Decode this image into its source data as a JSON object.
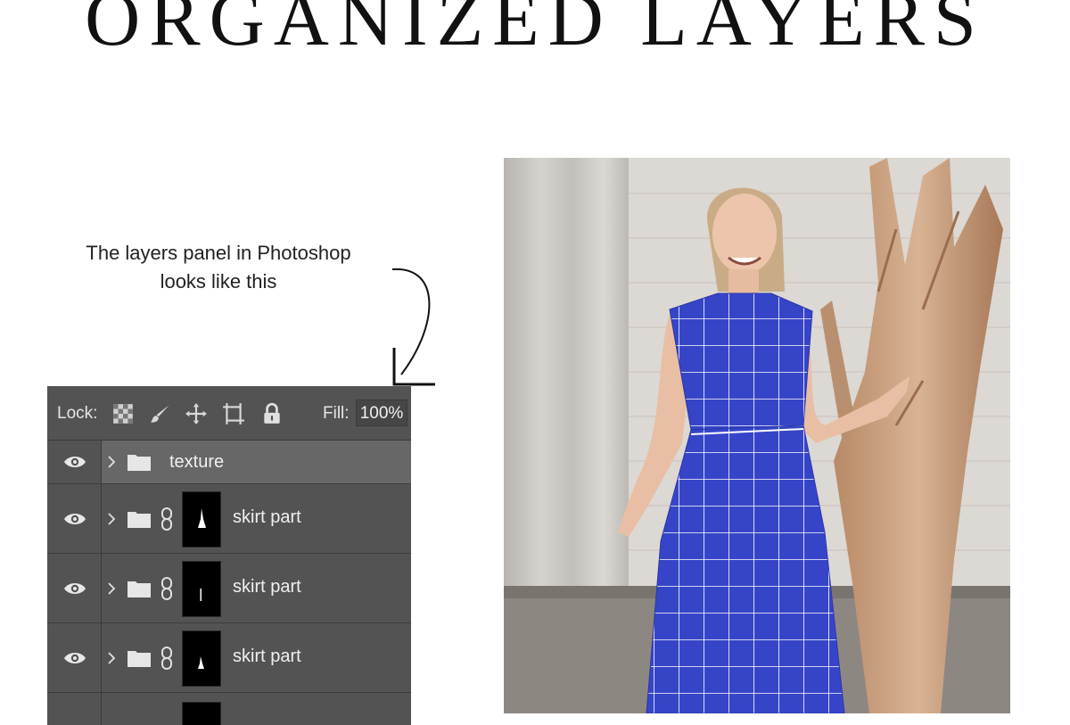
{
  "title": "ORGANIZED LAYERS",
  "caption": {
    "line1": "The layers panel in Photoshop",
    "line2": "looks like this"
  },
  "layers_panel": {
    "lock_label": "Lock:",
    "lock_icons": [
      "transparent-pixels-lock-icon",
      "brush-lock-icon",
      "move-lock-icon",
      "artboard-lock-icon",
      "padlock-icon"
    ],
    "fill_label": "Fill:",
    "fill_value": "100%",
    "layers": [
      {
        "name": "texture",
        "type": "group",
        "selected": true
      },
      {
        "name": "skirt part",
        "type": "group-with-mask"
      },
      {
        "name": "skirt part",
        "type": "group-with-mask"
      },
      {
        "name": "skirt part",
        "type": "group-with-mask"
      }
    ]
  },
  "colors": {
    "panel_bg": "#535353",
    "selected_row_bg": "#676767",
    "dress_blue": "#3645c8",
    "grid_line": "#ffffff"
  }
}
